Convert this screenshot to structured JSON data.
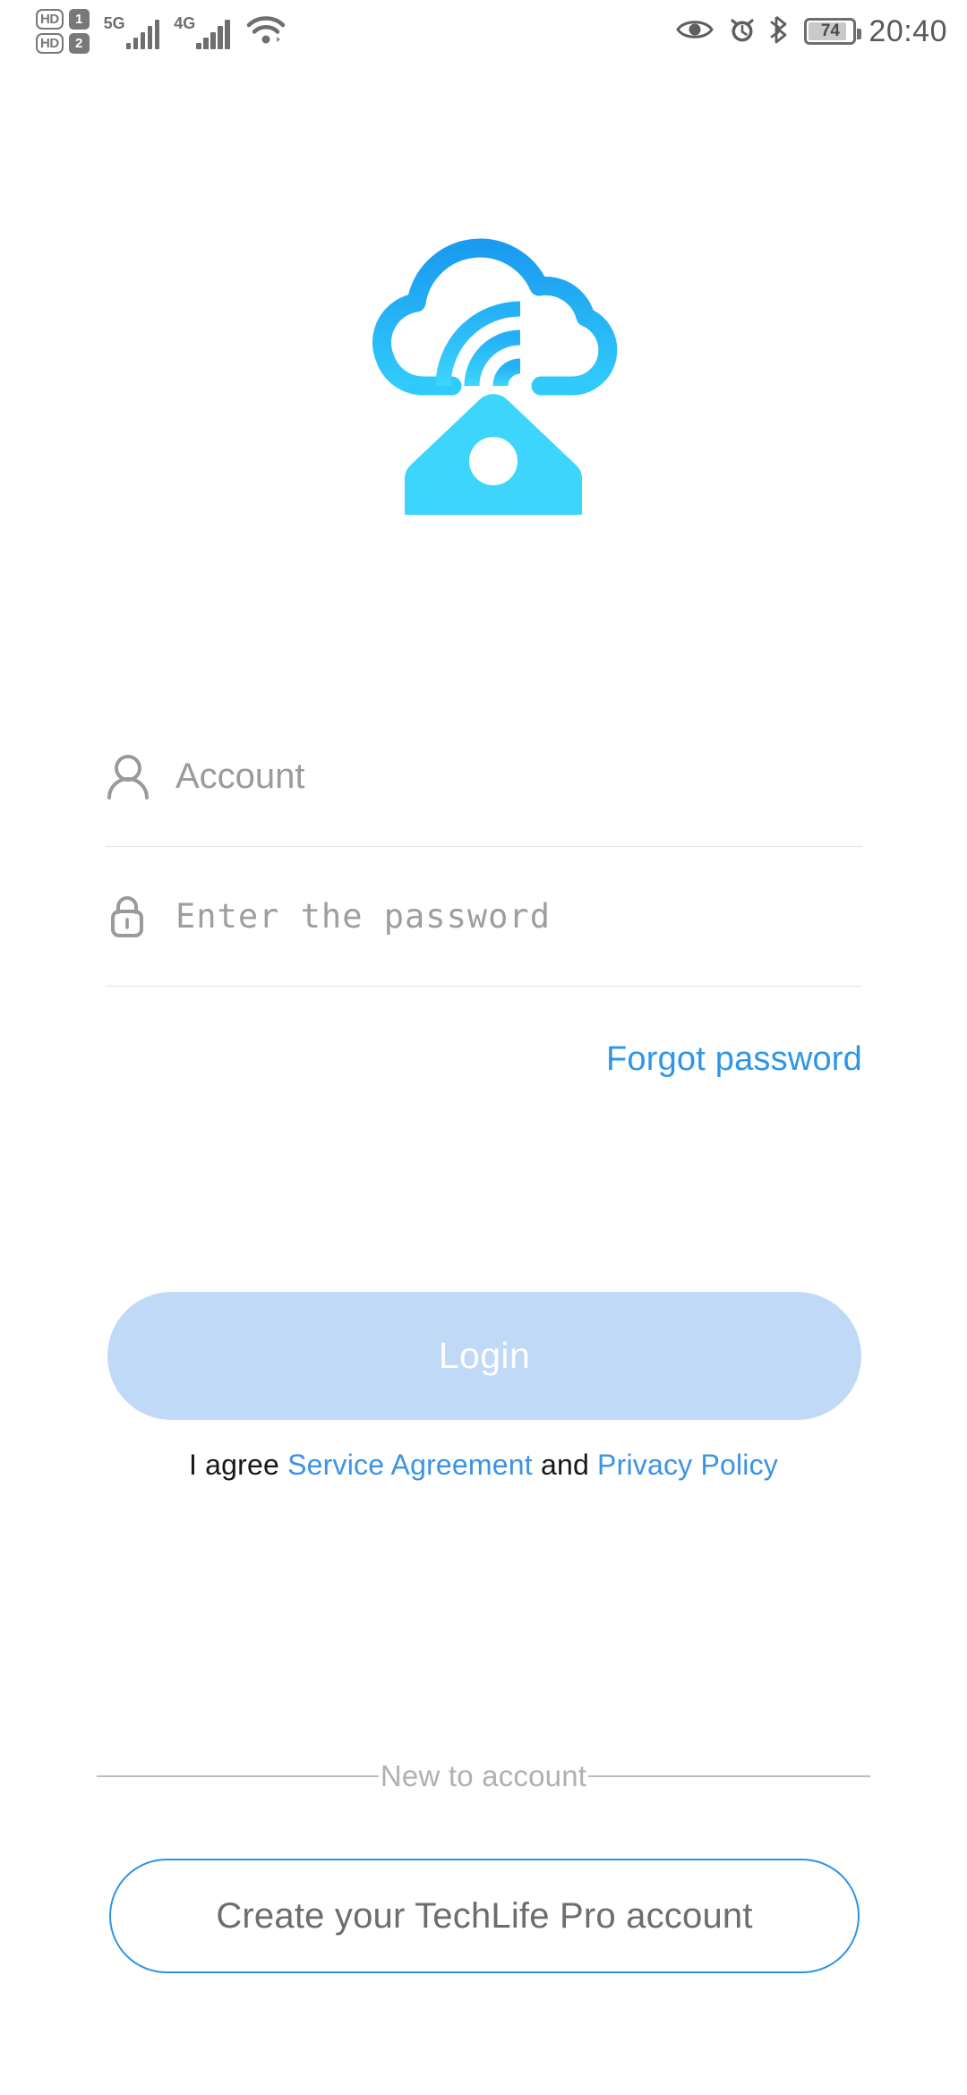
{
  "status_bar": {
    "sim1": {
      "hd_label": "HD",
      "slot": "1"
    },
    "sim2": {
      "hd_label": "HD",
      "slot": "2"
    },
    "network1_label": "5G",
    "network2_label": "4G",
    "wifi_icon": "wifi-icon",
    "eye_icon": "eye-care-icon",
    "alarm_icon": "alarm-clock-icon",
    "bluetooth_icon": "bluetooth-icon",
    "battery_percent": "74",
    "time": "20:40"
  },
  "logo": {
    "icon_name": "cloud-home-logo",
    "cloud_color_top": "#1a9bf0",
    "cloud_color_bottom": "#2fc9fb",
    "house_color": "#3dd5fc"
  },
  "form": {
    "account": {
      "icon_name": "person-icon",
      "placeholder": "Account",
      "value": ""
    },
    "password": {
      "icon_name": "lock-icon",
      "placeholder": "Enter the password",
      "value": ""
    },
    "forgot_password_label": "Forgot password"
  },
  "login": {
    "button_label": "Login",
    "button_color": "#bfd9f7",
    "button_text_color": "#ffffff",
    "agree_prefix": "I agree ",
    "service_agreement_label": "Service Agreement",
    "agree_middle": " and ",
    "privacy_policy_label": "Privacy Policy",
    "link_color": "#3a93e6"
  },
  "footer": {
    "divider_label": "New to account",
    "create_account_label": "Create your TechLife Pro account",
    "create_border_color": "#2e93e2"
  }
}
